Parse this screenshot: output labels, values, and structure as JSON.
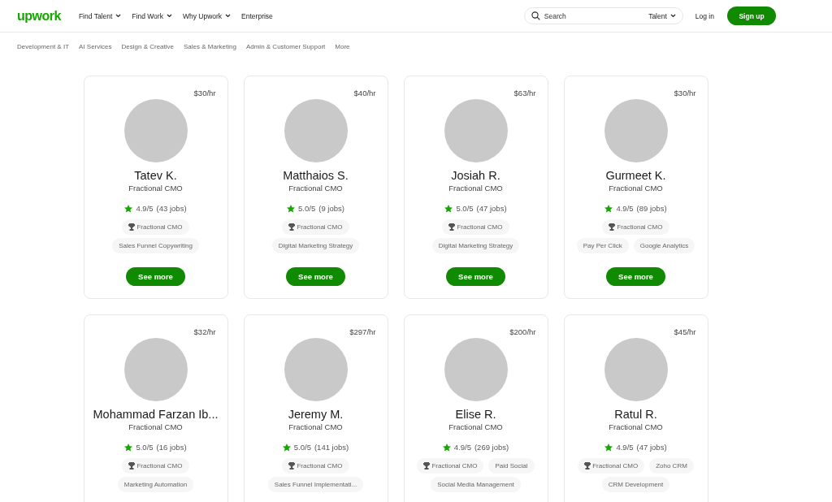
{
  "header": {
    "logo": "upwork",
    "nav": [
      {
        "label": "Find Talent",
        "dropdown": true
      },
      {
        "label": "Find Work",
        "dropdown": true
      },
      {
        "label": "Why Upwork",
        "dropdown": true
      },
      {
        "label": "Enterprise",
        "dropdown": false
      }
    ],
    "search": {
      "placeholder": "Search",
      "scope": "Talent"
    },
    "login": "Log in",
    "signup": "Sign up"
  },
  "categories": [
    "Development & IT",
    "AI Services",
    "Design & Creative",
    "Sales & Marketing",
    "Admin & Customer Support",
    "More"
  ],
  "cards": [
    {
      "rate": "$30/hr",
      "name": "Tatev K.",
      "title": "Fractional CMO",
      "rating": "4.9/5",
      "jobs": "(43 jobs)",
      "tag_rows": [
        [
          {
            "label": "Fractional CMO",
            "kind": "badge"
          }
        ],
        [
          {
            "label": "Sales Funnel Copywriting",
            "kind": "skill"
          }
        ]
      ],
      "button": "See more"
    },
    {
      "rate": "$40/hr",
      "name": "Matthaios S.",
      "title": "Fractional CMO",
      "rating": "5.0/5",
      "jobs": "(9 jobs)",
      "tag_rows": [
        [
          {
            "label": "Fractional CMO",
            "kind": "badge"
          }
        ],
        [
          {
            "label": "Digital Marketing Strategy",
            "kind": "skill"
          }
        ]
      ],
      "button": "See more"
    },
    {
      "rate": "$63/hr",
      "name": "Josiah R.",
      "title": "Fractional CMO",
      "rating": "5.0/5",
      "jobs": "(47 jobs)",
      "tag_rows": [
        [
          {
            "label": "Fractional CMO",
            "kind": "badge"
          }
        ],
        [
          {
            "label": "Digital Marketing Strategy",
            "kind": "skill"
          }
        ]
      ],
      "button": "See more"
    },
    {
      "rate": "$30/hr",
      "name": "Gurmeet K.",
      "title": "Fractional CMO",
      "rating": "4.9/5",
      "jobs": "(89 jobs)",
      "tag_rows": [
        [
          {
            "label": "Fractional CMO",
            "kind": "badge"
          }
        ],
        [
          {
            "label": "Pay Per Click",
            "kind": "skill"
          },
          {
            "label": "Google Analytics",
            "kind": "skill"
          }
        ]
      ],
      "button": "See more"
    },
    {
      "rate": "$32/hr",
      "name": "Mohammad Farzan Ib...",
      "title": "Fractional CMO",
      "rating": "5.0/5",
      "jobs": "(16 jobs)",
      "tag_rows": [
        [
          {
            "label": "Fractional CMO",
            "kind": "badge"
          }
        ],
        [
          {
            "label": "Marketing Automation",
            "kind": "skill"
          }
        ]
      ]
    },
    {
      "rate": "$297/hr",
      "name": "Jeremy M.",
      "title": "Fractional CMO",
      "rating": "5.0/5",
      "jobs": "(141 jobs)",
      "tag_rows": [
        [
          {
            "label": "Fractional CMO",
            "kind": "badge"
          }
        ],
        [
          {
            "label": "Sales Funnel Implementati...",
            "kind": "skill"
          }
        ]
      ]
    },
    {
      "rate": "$200/hr",
      "name": "Elise R.",
      "title": "Fractional CMO",
      "rating": "4.9/5",
      "jobs": "(269 jobs)",
      "tag_rows": [
        [
          {
            "label": "Fractional CMO",
            "kind": "badge"
          },
          {
            "label": "Paid Social",
            "kind": "skill"
          }
        ],
        [
          {
            "label": "Social Media Management",
            "kind": "skill"
          }
        ]
      ]
    },
    {
      "rate": "$45/hr",
      "name": "Ratul R.",
      "title": "Fractional CMO",
      "rating": "4.9/5",
      "jobs": "(47 jobs)",
      "tag_rows": [
        [
          {
            "label": "Fractional CMO",
            "kind": "badge"
          },
          {
            "label": "Zoho CRM",
            "kind": "skill"
          }
        ],
        [
          {
            "label": "CRM Development",
            "kind": "skill"
          }
        ]
      ]
    }
  ]
}
